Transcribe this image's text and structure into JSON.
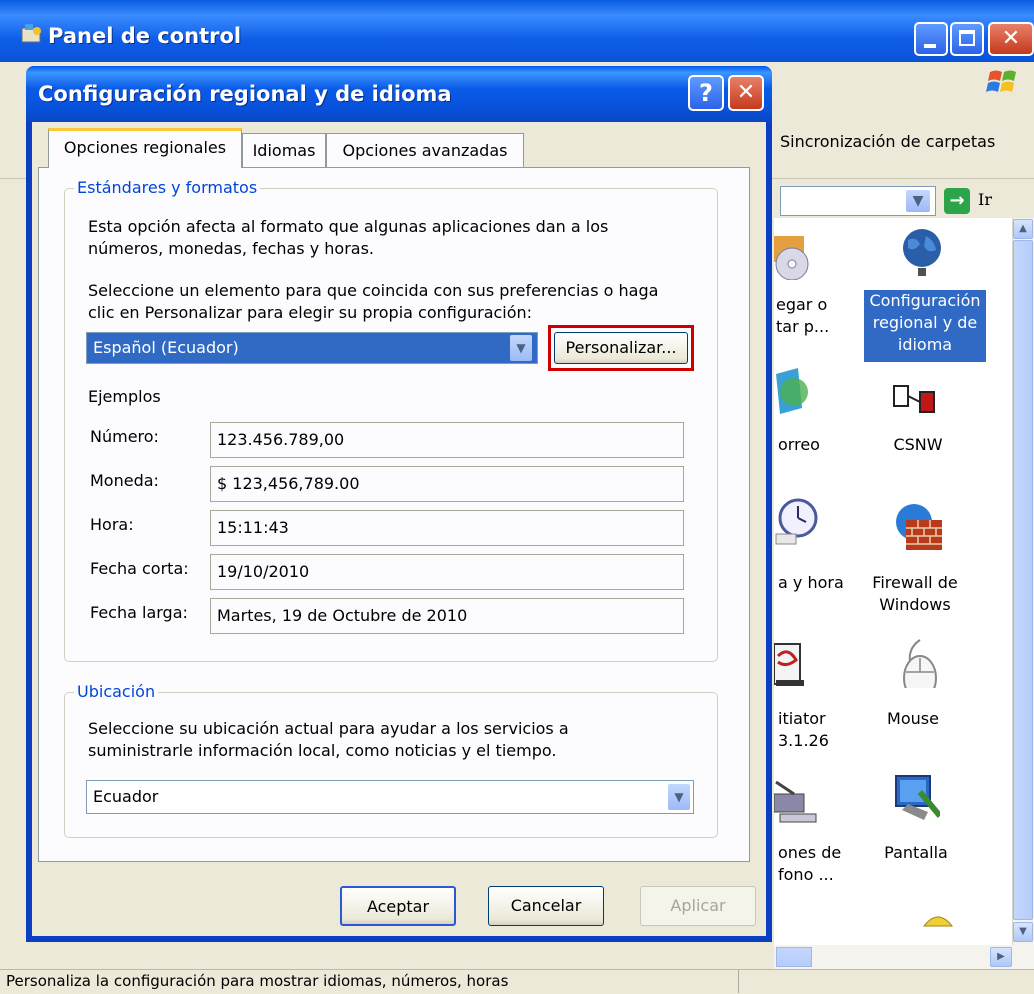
{
  "back_window": {
    "title": "Panel de control",
    "toolbar_label": "Sincronización de carpetas",
    "go_label": "Ir",
    "icons": [
      {
        "label_lines": [
          "egar o",
          "tar p..."
        ],
        "icon": "add-remove-programs-icon"
      },
      {
        "label_lines": [
          "Configuración",
          "regional y de",
          "idioma"
        ],
        "icon": "globe-icon",
        "selected": true
      },
      {
        "label_lines": [
          "orreo"
        ],
        "icon": "mail-icon"
      },
      {
        "label_lines": [
          "CSNW"
        ],
        "icon": "network-icon"
      },
      {
        "label_lines": [
          "a y hora"
        ],
        "icon": "clock-icon"
      },
      {
        "label_lines": [
          "Firewall de",
          "Windows"
        ],
        "icon": "firewall-icon"
      },
      {
        "label_lines": [
          "itiator",
          "3.1.26"
        ],
        "icon": "iscsi-icon"
      },
      {
        "label_lines": [
          "Mouse"
        ],
        "icon": "mouse-icon"
      },
      {
        "label_lines": [
          "ones de",
          "fono ..."
        ],
        "icon": "phone-icon"
      },
      {
        "label_lines": [
          "Pantalla"
        ],
        "icon": "display-icon"
      }
    ],
    "status_text": "Personaliza la configuración para mostrar idiomas, números, horas"
  },
  "dialog": {
    "title": "Configuración regional y de idioma",
    "help_glyph": "?",
    "close_glyph": "✕",
    "tabs": [
      "Opciones regionales",
      "Idiomas",
      "Opciones avanzadas"
    ],
    "active_tab": "Opciones regionales",
    "standards": {
      "group_label": "Estándares y formatos",
      "desc_line1": "Esta opción afecta al formato que algunas aplicaciones dan a los",
      "desc_line2": "números, monedas, fechas y horas.",
      "select_line1": "Seleccione un elemento para que coincida con sus preferencias o haga",
      "select_line2": "clic en Personalizar para elegir su propia configuración:",
      "locale_value": "Español (Ecuador)",
      "customize_label": "Personalizar...",
      "examples_label": "Ejemplos",
      "examples": [
        {
          "label": "Número:",
          "value": "123.456.789,00"
        },
        {
          "label": "Moneda:",
          "value": "$ 123,456,789.00"
        },
        {
          "label": "Hora:",
          "value": "15:11:43"
        },
        {
          "label": "Fecha corta:",
          "value": "19/10/2010"
        },
        {
          "label": "Fecha larga:",
          "value": "Martes, 19 de Octubre de 2010"
        }
      ]
    },
    "location": {
      "group_label": "Ubicación",
      "desc_line1": "Seleccione su ubicación actual para ayudar a los servicios a",
      "desc_line2": "suministrarle información local, como noticias y el tiempo.",
      "value": "Ecuador"
    },
    "buttons": {
      "ok": "Aceptar",
      "cancel": "Cancelar",
      "apply": "Aplicar"
    }
  },
  "colors": {
    "highlight_box": "#d00000",
    "selection_blue": "#316ac5",
    "group_label": "#0046d5"
  }
}
